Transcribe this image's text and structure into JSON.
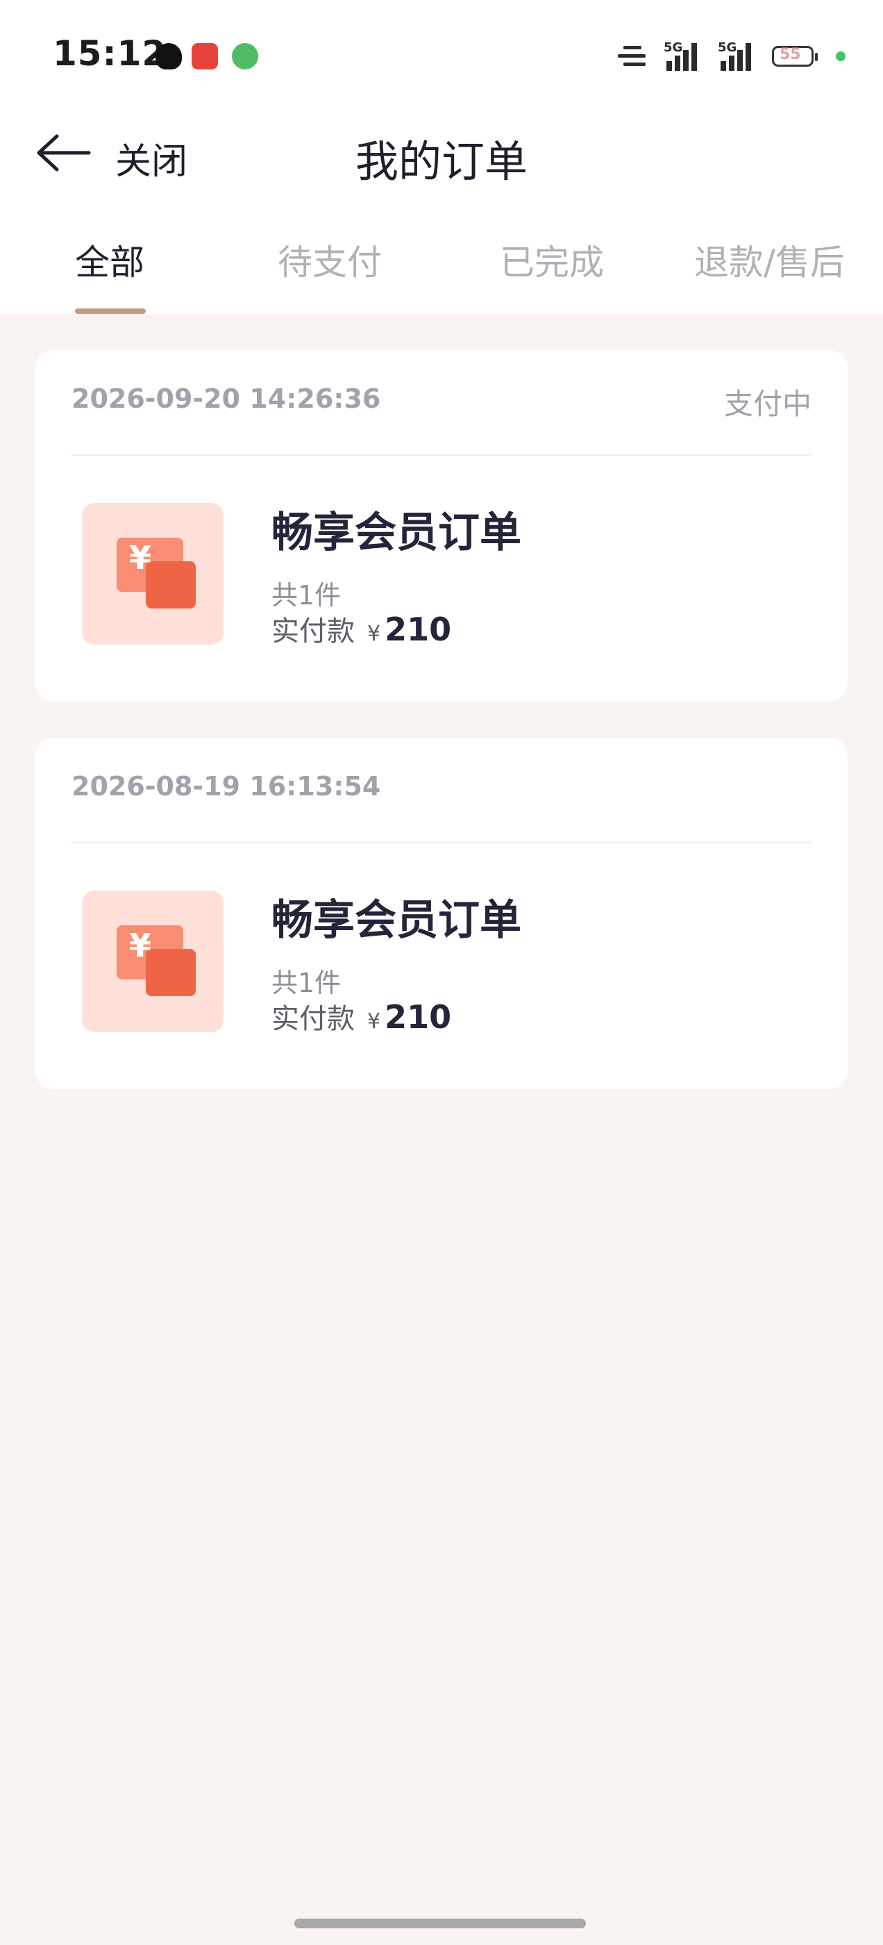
{
  "status_bar": {
    "time": "15:12",
    "signal1": "5G",
    "signal2": "5G",
    "battery": "55"
  },
  "nav": {
    "close_label": "关闭",
    "title": "我的订单"
  },
  "tabs": [
    {
      "label": "全部",
      "active": true
    },
    {
      "label": "待支付",
      "active": false
    },
    {
      "label": "已完成",
      "active": false
    },
    {
      "label": "退款/售后",
      "active": false
    }
  ],
  "orders": [
    {
      "datetime": "2026-09-20 14:26:36",
      "status": "支付中",
      "product_name": "畅享会员订单",
      "quantity_text": "共1件",
      "paid_label": "实付款",
      "currency": "¥",
      "amount": "210"
    },
    {
      "datetime": "2026-08-19 16:13:54",
      "status": "",
      "product_name": "畅享会员订单",
      "quantity_text": "共1件",
      "paid_label": "实付款",
      "currency": "¥",
      "amount": "210"
    }
  ],
  "icons": {
    "back": "arrow-left-icon",
    "product": "yen-chat-icon"
  },
  "colors": {
    "accent": "#c49a83",
    "background": "#f9f3f1"
  }
}
